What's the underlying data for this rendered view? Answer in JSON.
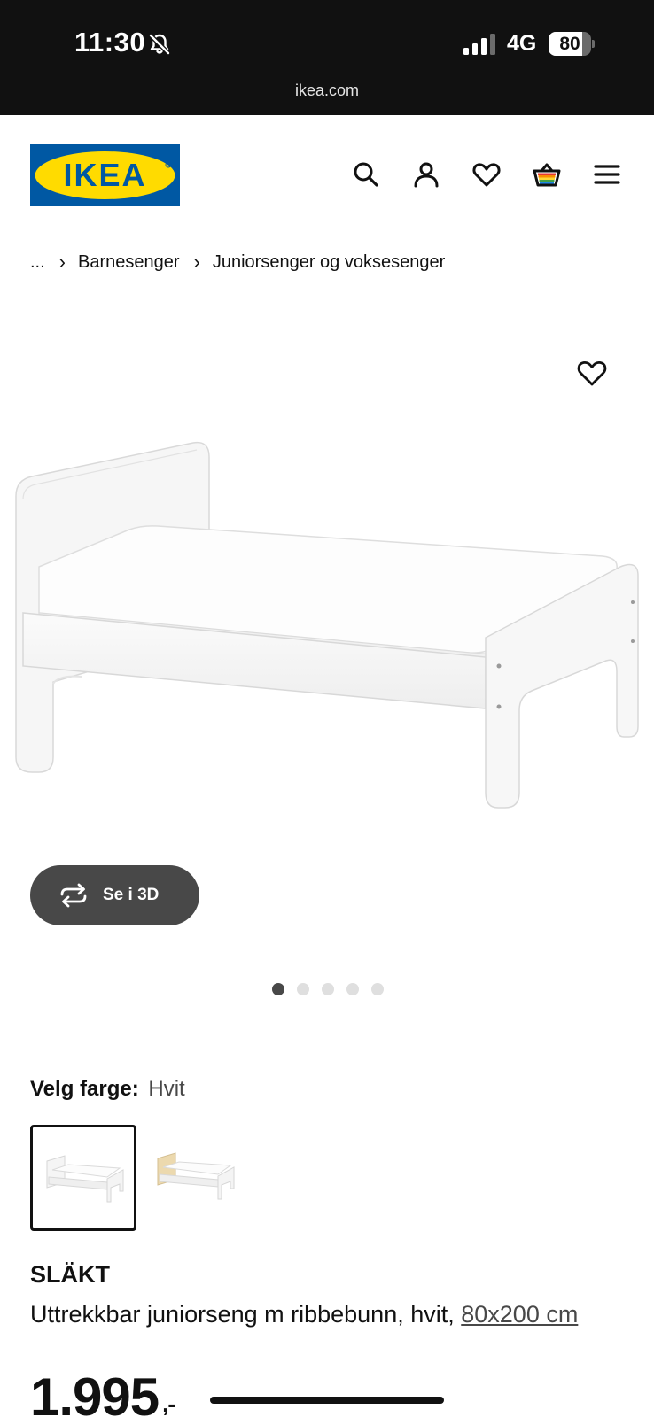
{
  "status_bar": {
    "time": "11:30",
    "network": "4G",
    "battery_level": 80,
    "battery_text": "80",
    "url": "ikea.com"
  },
  "header": {
    "logo_text": "IKEA",
    "brand_colors": {
      "blue": "#0058A3",
      "yellow": "#FFDB00"
    },
    "icons": [
      "search-icon",
      "account-icon",
      "heart-icon",
      "cart-icon",
      "menu-icon"
    ]
  },
  "breadcrumb": {
    "ellipsis": "...",
    "separator": "›",
    "items": [
      "Barnesenger",
      "Juniorsenger og voksesenger"
    ]
  },
  "gallery": {
    "view_3d_label": "Se i 3D",
    "slide_count": 5,
    "active_slide": 1
  },
  "color_picker": {
    "label": "Velg farge:",
    "selected_value": "Hvit",
    "options": [
      "white",
      "birch-white"
    ]
  },
  "product": {
    "name": "SLÄKT",
    "description": "Uttrekkbar juniorseng m ribbebunn, hvit, ",
    "size_link": "80x200 cm",
    "price": "1.995",
    "price_suffix": ",-"
  },
  "colors": {
    "dark_text": "#111111",
    "secondary_text": "#484848",
    "button_bg": "#484848"
  }
}
